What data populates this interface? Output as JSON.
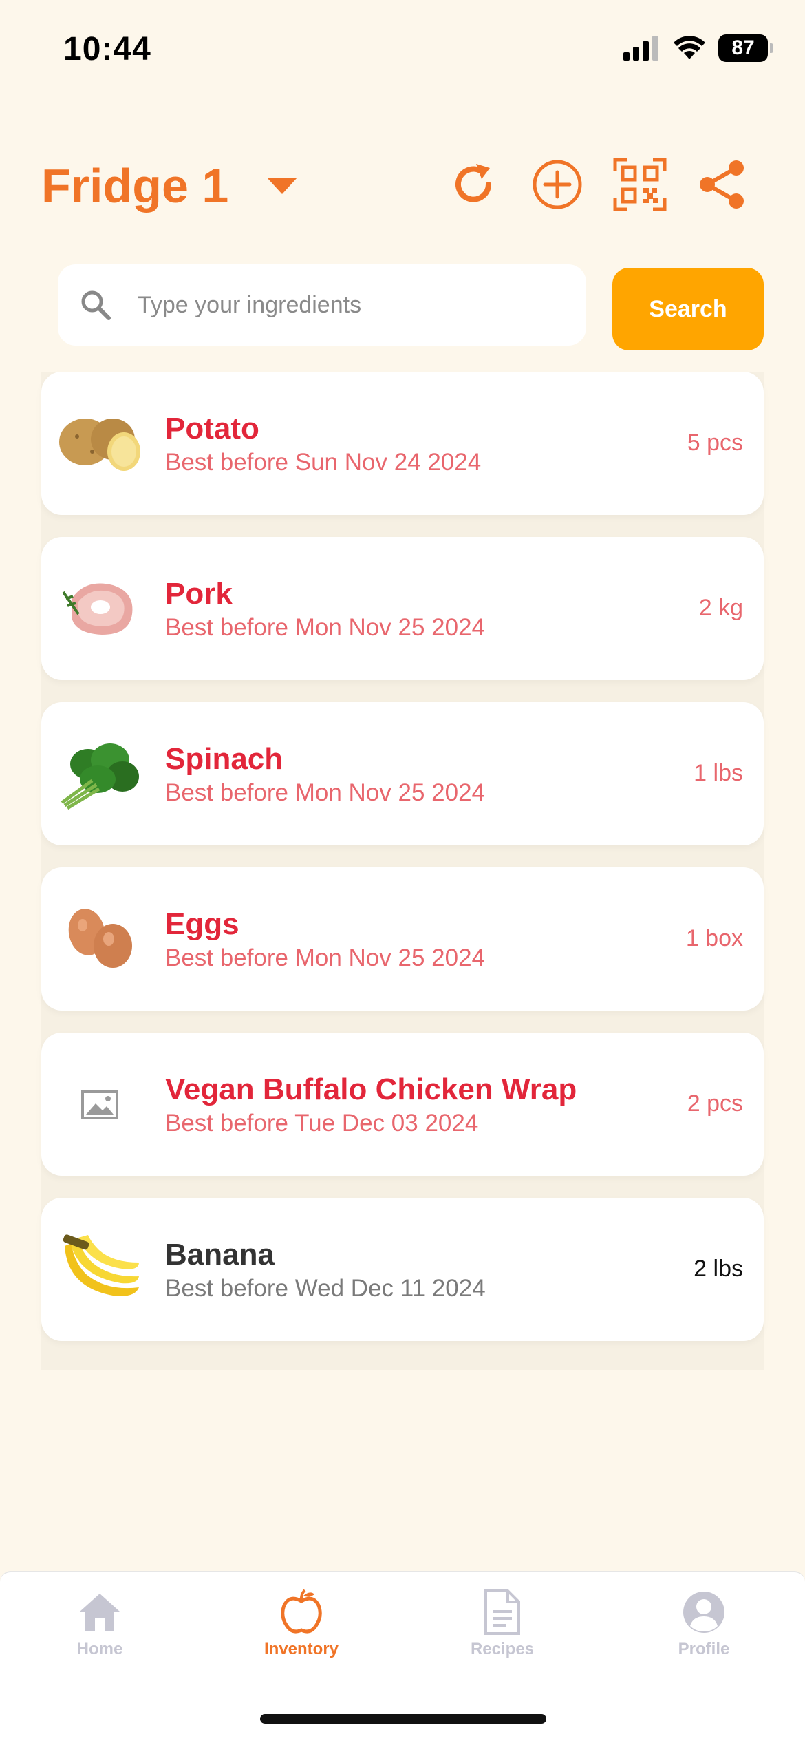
{
  "status_bar": {
    "time": "10:44",
    "battery": "87"
  },
  "header": {
    "title": "Fridge 1"
  },
  "search": {
    "placeholder": "Type your ingredients",
    "button_label": "Search"
  },
  "items": [
    {
      "name": "Potato",
      "date": "Best before Sun Nov 24 2024",
      "qty": "5 pcs",
      "image": "potato"
    },
    {
      "name": "Pork",
      "date": "Best before Mon Nov 25 2024",
      "qty": "2 kg",
      "image": "pork"
    },
    {
      "name": "Spinach",
      "date": "Best before Mon Nov 25 2024",
      "qty": "1 lbs",
      "image": "spinach"
    },
    {
      "name": "Eggs",
      "date": "Best before Mon Nov 25 2024",
      "qty": "1 box",
      "image": "eggs"
    },
    {
      "name": "Vegan Buffalo Chicken Wrap",
      "date": "Best before Tue Dec 03 2024",
      "qty": "2 pcs",
      "image": "image-placeholder-icon"
    },
    {
      "name": "Banana",
      "date": "Best before Wed Dec 11 2024",
      "qty": "2 lbs",
      "image": "banana"
    }
  ],
  "tabs": [
    {
      "label": "Home",
      "icon": "home-icon"
    },
    {
      "label": "Inventory",
      "icon": "apple-icon"
    },
    {
      "label": "Recipes",
      "icon": "document-icon"
    },
    {
      "label": "Profile",
      "icon": "user-icon"
    }
  ],
  "colors": {
    "accent": "#f07427",
    "search_button": "#ffa500",
    "expiring_text": "#e2263a",
    "background": "#fdf7eb"
  }
}
